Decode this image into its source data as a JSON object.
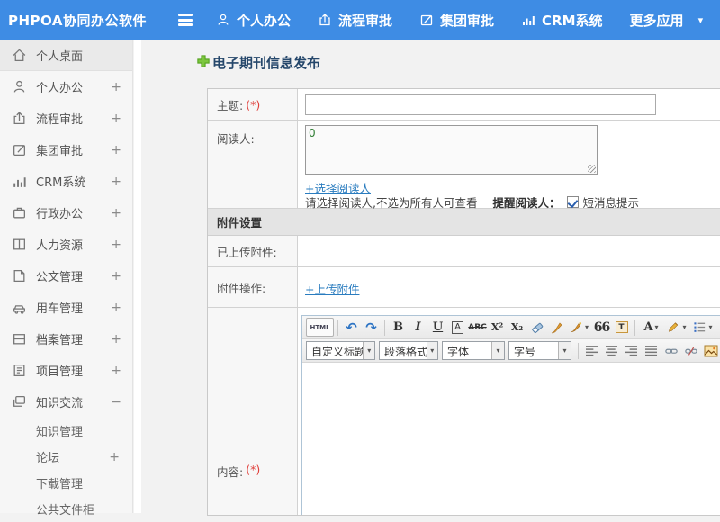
{
  "topbar": {
    "logo": "PHPOA协同办公软件",
    "menu": [
      {
        "label": "个人办公"
      },
      {
        "label": "流程审批"
      },
      {
        "label": "集团审批"
      },
      {
        "label": "CRM系统"
      }
    ],
    "more_label": "更多应用",
    "caret": "▾"
  },
  "sidebar": {
    "items": [
      {
        "label": "个人桌面",
        "expand": ""
      },
      {
        "label": "个人办公",
        "expand": "+"
      },
      {
        "label": "流程审批",
        "expand": "+"
      },
      {
        "label": "集团审批",
        "expand": "+"
      },
      {
        "label": "CRM系统",
        "expand": "+"
      },
      {
        "label": "行政办公",
        "expand": "+"
      },
      {
        "label": "人力资源",
        "expand": "+"
      },
      {
        "label": "公文管理",
        "expand": "+"
      },
      {
        "label": "用车管理",
        "expand": "+"
      },
      {
        "label": "档案管理",
        "expand": "+"
      },
      {
        "label": "项目管理",
        "expand": "+"
      },
      {
        "label": "知识交流",
        "expand": "−"
      }
    ],
    "subitems": [
      {
        "label": "知识管理",
        "expand": ""
      },
      {
        "label": "论坛",
        "expand": "+"
      },
      {
        "label": "下载管理",
        "expand": ""
      },
      {
        "label": "公共文件柜",
        "expand": ""
      }
    ]
  },
  "page": {
    "title": "电子期刊信息发布"
  },
  "form": {
    "subject_label": "主题:",
    "required_mark": "(*)",
    "subject_value": "",
    "readers_label": "阅读人:",
    "readers_value": "0",
    "select_readers_link": "+选择阅读人",
    "readers_note": "请选择阅读人,不选为所有人可查看",
    "remind_label": "提醒阅读人：",
    "sms_label": "短消息提示",
    "attachment_section": "附件设置",
    "uploaded_label": "已上传附件:",
    "action_label": "附件操作:",
    "upload_link": "+上传附件",
    "content_label": "内容:"
  },
  "editor": {
    "html_label": "HTML",
    "undo": "↶",
    "redo": "↷",
    "bold": "B",
    "italic": "I",
    "underline": "U",
    "font_box": "A",
    "strike": "ABC",
    "superscript": "X²",
    "subscript": "X₂",
    "quote": "66",
    "paste_t": "T",
    "font_color": "A",
    "selects": [
      "自定义标题",
      "段落格式",
      "字体",
      "字号"
    ]
  },
  "colors": {
    "topbar_blue": "#3e8ce4",
    "link_blue": "#2a7cbf",
    "required_red": "#e0403c",
    "title_navy": "#25476b",
    "section_gray": "#e4e4e4"
  }
}
